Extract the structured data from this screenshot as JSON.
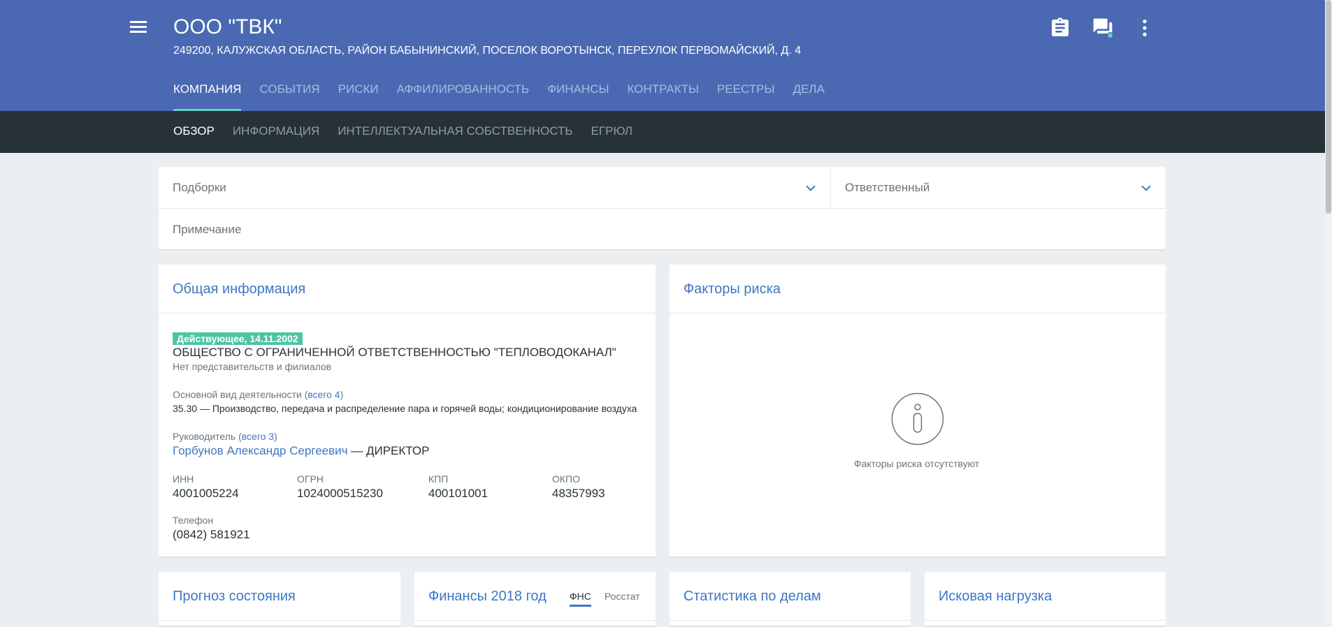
{
  "header": {
    "title": "ООО \"ТВК\"",
    "address": "249200, КАЛУЖСКАЯ ОБЛАСТЬ, РАЙОН БАБЫНИНСКИЙ, ПОСЕЛОК ВОРОТЫНСК, ПЕРЕУЛОК ПЕРВОМАЙСКИЙ, Д. 4",
    "icons": [
      "menu-icon",
      "clipboard-icon",
      "chat-icon",
      "more-vert-icon"
    ],
    "tabs": [
      {
        "label": "КОМПАНИЯ",
        "active": true
      },
      {
        "label": "СОБЫТИЯ"
      },
      {
        "label": "РИСКИ"
      },
      {
        "label": "АФФИЛИРОВАННОСТЬ"
      },
      {
        "label": "ФИНАНСЫ"
      },
      {
        "label": "КОНТРАКТЫ"
      },
      {
        "label": "РЕЕСТРЫ"
      },
      {
        "label": "ДЕЛА"
      }
    ]
  },
  "subnav": {
    "tabs": [
      {
        "label": "ОБЗОР",
        "active": true
      },
      {
        "label": "ИНФОРМАЦИЯ"
      },
      {
        "label": "ИНТЕЛЛЕКТУАЛЬНАЯ СОБСТВЕННОСТЬ"
      },
      {
        "label": "ЕГРЮЛ"
      }
    ]
  },
  "filters": {
    "collections_label": "Подборки",
    "responsible_label": "Ответственный",
    "note_placeholder": "Примечание"
  },
  "general_info": {
    "title": "Общая информация",
    "status": "Действующее, 14.11.2002",
    "full_name": "ОБЩЕСТВО С ОГРАНИЧЕННОЙ ОТВЕТСТВЕННОСТЬЮ \"ТЕПЛОВОДОКАНАЛ\"",
    "branches": "Нет представительств и филиалов",
    "activity_label": "Основной вид деятельности (",
    "activity_link": "всего 4",
    "activity_close": ")",
    "activity_value": "35.30 — Производство, передача и распределение пара и горячей воды; кондиционирование воздуха",
    "head_label": "Руководитель (",
    "head_link": "всего 3",
    "head_close": ")",
    "head_name": "Горбунов Александр Сергеевич",
    "head_role": " — ДИРЕКТОР",
    "inn_label": "ИНН",
    "inn_value": "4001005224",
    "ogrn_label": "ОГРН",
    "ogrn_value": "1024000515230",
    "kpp_label": "КПП",
    "kpp_value": "400101001",
    "okpo_label": "ОКПО",
    "okpo_value": "48357993",
    "phone_label": "Телефон",
    "phone_value": "(0842) 581921"
  },
  "risk_factors": {
    "title": "Факторы риска",
    "empty_text": "Факторы риска отсутствуют",
    "icon": "info-icon"
  },
  "bottom_cards": {
    "forecast_title": "Прогноз состояния",
    "finance_title": "Финансы 2018 год",
    "finance_tab_fns": "ФНС",
    "finance_tab_rosstat": "Росстат",
    "cases_title": "Статистика по делам",
    "claims_title": "Исковая нагрузка"
  },
  "colors": {
    "header_bg": "#4a69b2",
    "subnav_bg": "#263238",
    "accent": "#5ed3b9",
    "link": "#3e76c4",
    "status_badge": "#4fc4a5"
  }
}
